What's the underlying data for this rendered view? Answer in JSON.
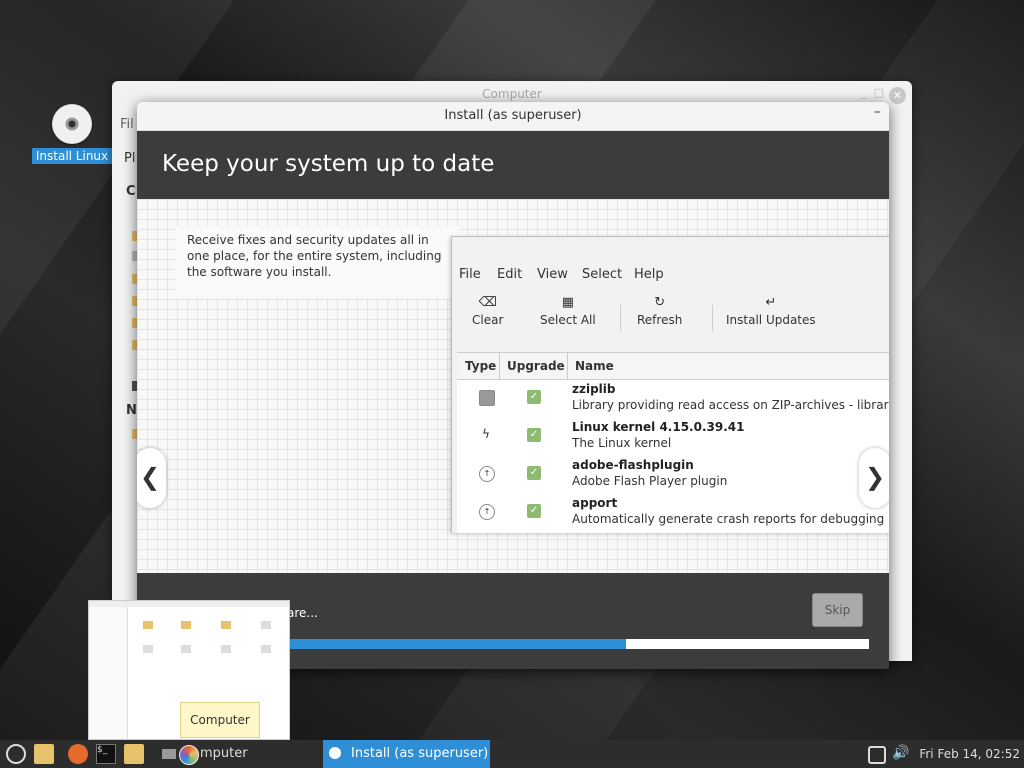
{
  "desktop": {
    "icon_label": "Install Linux"
  },
  "computer_window": {
    "title": "Computer",
    "menu_partial": "Fil",
    "places_partial": "Pl",
    "section_c": "C",
    "section_n": "N"
  },
  "install_window": {
    "title": "Install (as superuser)",
    "minimize_glyph": "–",
    "heading": "Keep your system up to date",
    "description": "Receive fixes and security updates all in one place, for the entire system, including the software you install.",
    "footer_text": "are...",
    "skip_label": "Skip",
    "progress": 0.59,
    "prev_glyph": "❮",
    "next_glyph": "❯"
  },
  "update_manager": {
    "menu": [
      "File",
      "Edit",
      "View",
      "Select",
      "Help"
    ],
    "toolbar": [
      {
        "label": "Clear",
        "icon": "backspace-icon"
      },
      {
        "label": "Select All",
        "icon": "select-all-icon"
      },
      {
        "label": "Refresh",
        "icon": "refresh-icon"
      },
      {
        "label": "Install Updates",
        "icon": "return-icon"
      }
    ],
    "columns": [
      "Type",
      "Upgrade",
      "Name"
    ],
    "rows": [
      {
        "name": "zziplib",
        "desc": "Library providing read access on ZIP-archives - library",
        "type_icon": "shield-icon"
      },
      {
        "name": "Linux kernel 4.15.0.39.41",
        "desc": "The Linux kernel",
        "type_icon": "lightning-icon"
      },
      {
        "name": "adobe-flashplugin",
        "desc": "Adobe Flash Player plugin",
        "type_icon": "up-arrow-icon"
      },
      {
        "name": "apport",
        "desc": "Automatically generate crash reports for debugging",
        "type_icon": "up-arrow-icon"
      }
    ]
  },
  "tooltip": "Computer",
  "taskbar": {
    "computer_label": "mputer",
    "install_label": "Install (as superuser)",
    "clock": "Fri Feb 14, 02:52"
  },
  "colors": {
    "accent": "#2e8fd6",
    "header_bg": "#3c3c3c",
    "check_green": "#8dbb72"
  }
}
